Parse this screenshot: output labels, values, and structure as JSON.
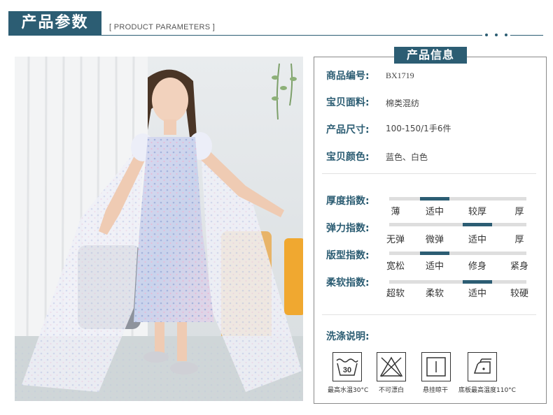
{
  "header": {
    "title": "产品参数",
    "subtitle": "[ PRODUCT PARAMETERS ]"
  },
  "panel": {
    "title": "产品信息",
    "info": [
      {
        "label": "商品编号:",
        "value": "BX1719"
      },
      {
        "label": "宝贝面料:",
        "value": "棉类混纺"
      },
      {
        "label": "产品尺寸:",
        "value": "100-150/1手6件"
      },
      {
        "label": "宝贝颜色:",
        "value": "蓝色、白色"
      }
    ],
    "scales": [
      {
        "label": "厚度指数:",
        "options": [
          "薄",
          "适中",
          "较厚",
          "厚"
        ],
        "selected": 1
      },
      {
        "label": "弹力指数:",
        "options": [
          "无弹",
          "微弹",
          "适中",
          "厚"
        ],
        "selected": 2
      },
      {
        "label": "版型指数:",
        "options": [
          "宽松",
          "适中",
          "修身",
          "紧身"
        ],
        "selected": 1
      },
      {
        "label": "柔软指数:",
        "options": [
          "超软",
          "柔软",
          "适中",
          "较硬"
        ],
        "selected": 2
      }
    ],
    "wash": {
      "title": "洗涤说明:",
      "items": [
        {
          "icon": "wash-30-icon",
          "temp": "30",
          "caption": "最高水温30°C"
        },
        {
          "icon": "no-bleach-icon",
          "caption": "不可漂白"
        },
        {
          "icon": "hang-dry-icon",
          "caption": "悬挂晾干"
        },
        {
          "icon": "iron-icon",
          "caption": "底板最高温度110°C"
        }
      ]
    }
  },
  "colors": {
    "accent": "#2c5d73"
  }
}
